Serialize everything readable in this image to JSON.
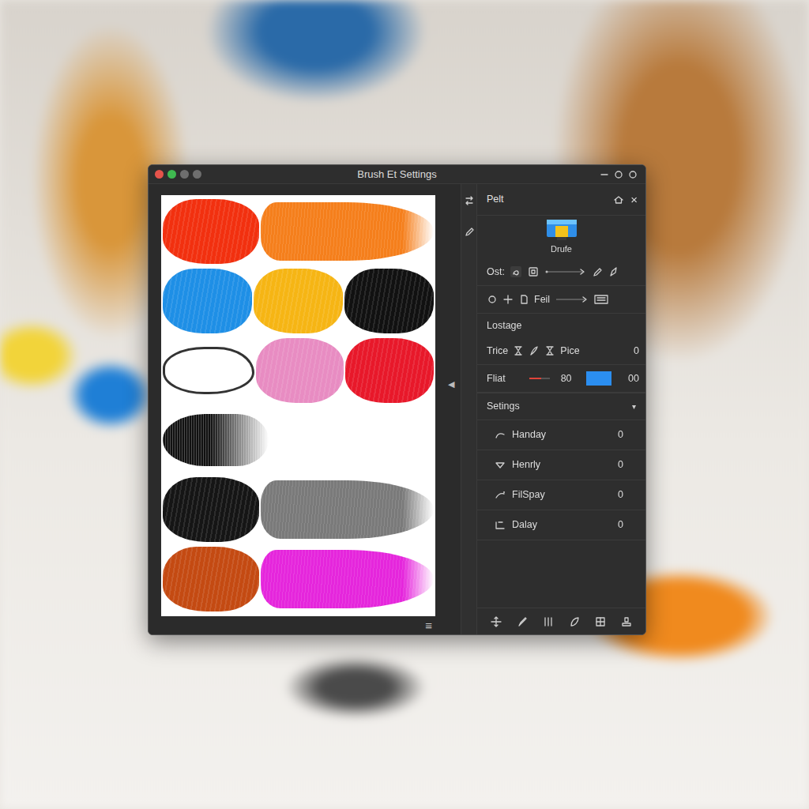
{
  "window": {
    "title": "Brush Et Settings",
    "lights": [
      {
        "color": "#e5534b"
      },
      {
        "color": "#3fb950"
      },
      {
        "color": "#6e6e6e"
      },
      {
        "color": "#6e6e6e"
      }
    ]
  },
  "canvas": {
    "rows": [
      [
        {
          "kind": "blob",
          "color": "#f2300f"
        },
        {
          "kind": "stroke",
          "color": "#f57f1c"
        }
      ],
      [
        {
          "kind": "blob",
          "color": "#1e8fe6"
        },
        {
          "kind": "blob",
          "color": "#f6b514"
        },
        {
          "kind": "blob",
          "color": "#111111"
        }
      ],
      [
        {
          "kind": "outline",
          "color": "#333333"
        },
        {
          "kind": "blob",
          "color": "#e88cc2"
        },
        {
          "kind": "blob",
          "color": "#e8182a"
        }
      ],
      [
        {
          "kind": "fade",
          "color": "#111111"
        }
      ],
      [
        {
          "kind": "blob",
          "color": "#151515"
        },
        {
          "kind": "stroke",
          "color": "#7a7a7a"
        }
      ],
      [
        {
          "kind": "blob",
          "color": "#c44a12"
        },
        {
          "kind": "stroke",
          "color": "#e526dc"
        }
      ]
    ],
    "menu": "≡"
  },
  "divider": {
    "arrow": "◀"
  },
  "panel": {
    "title": "Pelt",
    "close": "×",
    "preset": {
      "label": "Drufe"
    },
    "ost": {
      "label": "Ost:"
    },
    "feil": {
      "label": "Feil"
    },
    "section": {
      "title": "Lostage"
    },
    "trice": {
      "label": "Trice",
      "sub": "Pice",
      "value": "0"
    },
    "fliat": {
      "label": "Fliat",
      "level": 0.6,
      "reading": "80",
      "color": "#2b8ef0",
      "value": "00"
    },
    "settings": {
      "title": "Setings",
      "caret": "▾",
      "expanded": true,
      "items": [
        {
          "label": "Handay",
          "value": "0"
        },
        {
          "label": "Henrly",
          "value": "0"
        },
        {
          "label": "FilSpay",
          "value": "0"
        },
        {
          "label": "Dalay",
          "value": "0"
        }
      ]
    }
  }
}
